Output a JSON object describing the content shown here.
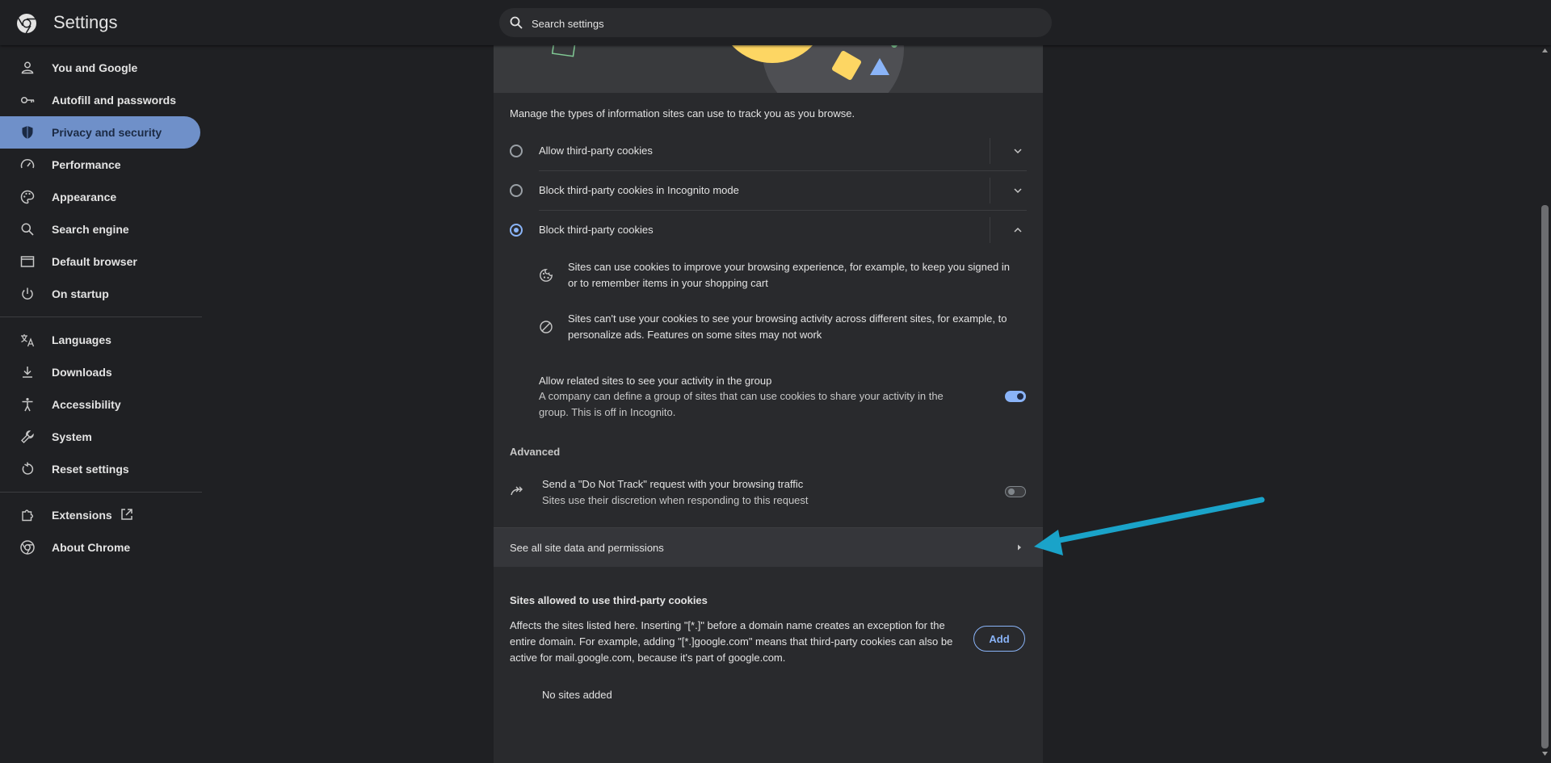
{
  "header": {
    "title": "Settings",
    "search_placeholder": "Search settings",
    "logo_icon": "chrome-logo-icon"
  },
  "sidebar": {
    "items": [
      {
        "label": "You and Google",
        "icon": "person-icon"
      },
      {
        "label": "Autofill and passwords",
        "icon": "key-icon"
      },
      {
        "label": "Privacy and security",
        "icon": "shield-icon",
        "active": true
      },
      {
        "label": "Performance",
        "icon": "speedometer-icon"
      },
      {
        "label": "Appearance",
        "icon": "palette-icon"
      },
      {
        "label": "Search engine",
        "icon": "search-icon"
      },
      {
        "label": "Default browser",
        "icon": "browser-window-icon"
      },
      {
        "label": "On startup",
        "icon": "power-icon"
      },
      {
        "label": "Languages",
        "icon": "translate-icon"
      },
      {
        "label": "Downloads",
        "icon": "download-icon"
      },
      {
        "label": "Accessibility",
        "icon": "accessibility-icon"
      },
      {
        "label": "System",
        "icon": "wrench-icon"
      },
      {
        "label": "Reset settings",
        "icon": "reset-icon"
      },
      {
        "label": "Extensions",
        "icon": "puzzle-icon"
      },
      {
        "label": "About Chrome",
        "icon": "chrome-icon"
      }
    ]
  },
  "main": {
    "intro": "Manage the types of information sites can use to track you as you browse.",
    "cookie_options": [
      {
        "label": "Allow third-party cookies",
        "selected": false
      },
      {
        "label": "Block third-party cookies in Incognito mode",
        "selected": false
      },
      {
        "label": "Block third-party cookies",
        "selected": true
      }
    ],
    "details": [
      {
        "icon": "cookie-icon",
        "text": "Sites can use cookies to improve your browsing experience, for example, to keep you signed in or to remember items in your shopping cart"
      },
      {
        "icon": "block-icon",
        "text": "Sites can't use your cookies to see your browsing activity across different sites, for example, to personalize ads. Features on some sites may not work"
      }
    ],
    "related_sites": {
      "title": "Allow related sites to see your activity in the group",
      "description": "A company can define a group of sites that can use cookies to share your activity in the group. This is off in Incognito.",
      "enabled": true
    },
    "advanced_heading": "Advanced",
    "do_not_track": {
      "title": "Send a \"Do Not Track\" request with your browsing traffic",
      "description": "Sites use their discretion when responding to this request",
      "enabled": false
    },
    "all_site_data_label": "See all site data and permissions",
    "allowed_sites": {
      "heading": "Sites allowed to use third-party cookies",
      "description": "Affects the sites listed here. Inserting \"[*.]\" before a domain name creates an exception for the entire domain. For example, adding \"[*.]google.com\" means that third-party cookies can also be active for mail.google.com, because it's part of google.com.",
      "add_label": "Add",
      "empty_text": "No sites added"
    }
  },
  "colors": {
    "background": "#1f2023",
    "card": "#292a2d",
    "accent": "#8ab4f8",
    "active_nav": "#6f90c9",
    "annotation_arrow": "#1aa3c9"
  }
}
